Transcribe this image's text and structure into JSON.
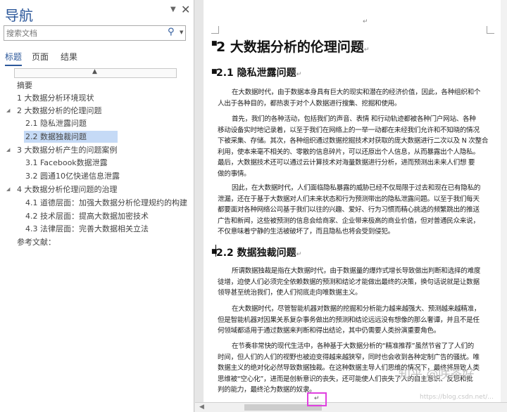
{
  "nav": {
    "title": "导航",
    "dropdown_icon": "chevron-down-icon",
    "close_icon": "close-icon",
    "search_placeholder": "搜索文档",
    "tabs": [
      "标题",
      "页面",
      "结果"
    ],
    "items": [
      {
        "label": "摘要",
        "level": 1,
        "expandable": false,
        "selected": false
      },
      {
        "label": "1 大数据分析环境现状",
        "level": 1,
        "expandable": false,
        "selected": false
      },
      {
        "label": "2 大数据分析的伦理问题",
        "level": 1,
        "expandable": true,
        "selected": false
      },
      {
        "label": "2.1 隐私泄露问题",
        "level": 2,
        "expandable": false,
        "selected": false
      },
      {
        "label": "2.2 数据独裁问题",
        "level": 2,
        "expandable": false,
        "selected": true
      },
      {
        "label": "3 大数据分析产生的问题案例",
        "level": 1,
        "expandable": true,
        "selected": false
      },
      {
        "label": "3.1 Facebook数据泄露",
        "level": 2,
        "expandable": false,
        "selected": false
      },
      {
        "label": "3.2 圆通10亿快递信息泄露",
        "level": 2,
        "expandable": false,
        "selected": false
      },
      {
        "label": "4 大数据分析伦理问题的治理",
        "level": 1,
        "expandable": true,
        "selected": false
      },
      {
        "label": "4.1 道德层面：加强大数据分析伦理规约的构建",
        "level": 2,
        "expandable": false,
        "selected": false
      },
      {
        "label": "4.2 技术层面：提高大数据加密技术",
        "level": 2,
        "expandable": false,
        "selected": false
      },
      {
        "label": "4.3 法律层面：完善大数据相关立法",
        "level": 2,
        "expandable": false,
        "selected": false
      },
      {
        "label": "参考文献：",
        "level": 1,
        "expandable": false,
        "selected": false
      }
    ]
  },
  "doc": {
    "h1": "2  大数据分析的伦理问题",
    "h2a": "2.1  隐私泄露问题",
    "p1": [
      "在大数据时代，由于数据本身具有巨大的现实和潜在的经济价值，因此，各种组织和个",
      "人出于各种目的，都热衷于对个人数据进行搜集、挖掘和使用。"
    ],
    "p2": [
      "首先，我们的各种活动，包括我们的声音、表情  和行动轨迹都被各种门户网站、各种",
      "移动设备实时地记录着，以至于我们在网络上的一举一动都在未经我们允许和不知晓的情况",
      "下被采集、存储。其次，各种组织通过数据挖掘技术对获取的庞大数据进行二次以及 N 次整合",
      "利用，使本来毫不相关的、零散的信息碎片，可以还原出个人信息，从而暴露出个人隐私。",
      "最后，大数据技术还可以通过云计算技术对海量数据进行分析，进而预测出未来人们想  要",
      "做的事情。"
    ],
    "p3": [
      "因此，在大数据时代，人们面临隐私暴露的威胁已经不仅局限于过去和现在已有隐私的",
      "泄漏，还在于基于大数据对人们未来状态和行为预测带出的隐私泄露问题。以至于我们每天",
      "都要面对各种网络公司基于我们以往的兴趣、爱好、行为习惯而精心挑选的频繁跳出的推送",
      "广告和新闻，这些被预测的信息会给商家、企业带来极高的商业价值，但对普通民众来说，",
      "不仅意味着宁静的生活被破坏了，而且隐私也将会受到侵犯。"
    ],
    "h2b": "2.2  数据独裁问题",
    "p4": [
      "所谓数据独裁是指在大数据时代，由于数据量的爆炸式增长导致做出判断和选择的难度",
      "徒增，迫使人们必须完全依赖数据的预测和结论才能做出最终的决策，换句话说就是让数据",
      "领导甚至统治我们，使人们彻底走向唯数据主义。"
    ],
    "p5": [
      "在大数据时代，尽管智能机器对数据的挖掘和分析能力越来越强大、预测越来越精准，",
      "但是智能机器对因果关系复杂事务做出的预测和结论远远没有想像的那么奢谭，并且不是任",
      "何领域都适用于通过数据来判断和得出结论，其中仍需要人类扮演重要角色。"
    ],
    "p6": [
      "在节奏非常快的现代生活中，各种基于大数据分析的“精准推荐”虽然节省了了人们的",
      "时间，但人们的人们的视野也被迫变得越来越狭窄，同时也会收到各种定制广告的骚扰。唯",
      "数据主义的绝对化必然导致数据独裁。在这种数据主导人们思维的情况下，最终将导致人类",
      "思维被“空心化”，进而是创新意识的丧失，还可能使人们丧失了人的自主意识、反思和批",
      "判的能力，最终沦为数据的奴隶。"
    ],
    "para_mark": "↵"
  },
  "watermark": "知乎 @咲茶好",
  "watermark_url": "https://blog.csdn.net/..."
}
